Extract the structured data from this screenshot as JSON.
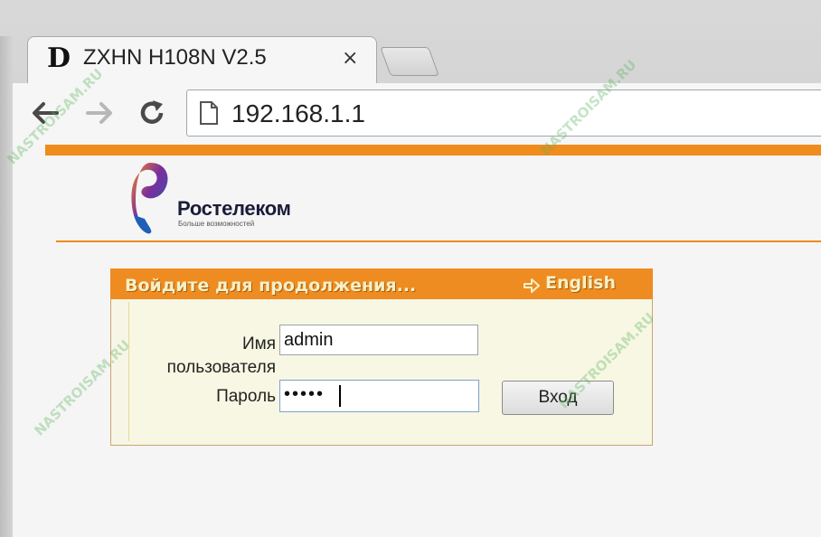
{
  "browser": {
    "tab": {
      "favicon": "D",
      "title": "ZXHN H108N V2.5",
      "close": "×"
    },
    "address_bar": {
      "url": "192.168.1.1"
    },
    "icons": [
      "back-arrow-icon",
      "forward-arrow-icon",
      "reload-icon",
      "page-icon"
    ]
  },
  "page": {
    "brand": {
      "name": "Ростелеком",
      "slogan": "Больше возможностей"
    },
    "login_panel": {
      "title": "Войдите для продолжения...",
      "language_link": "English",
      "username_label": "Имя пользователя",
      "username_value": "admin",
      "password_label": "Пароль",
      "password_value": "•••••",
      "submit_label": "Вход"
    },
    "watermark": "NASTROISAM.RU"
  },
  "colors": {
    "accent_orange": "#ef8c1c",
    "panel_bg": "#f7f6e6",
    "brand_blue": "#1f5fb8"
  }
}
